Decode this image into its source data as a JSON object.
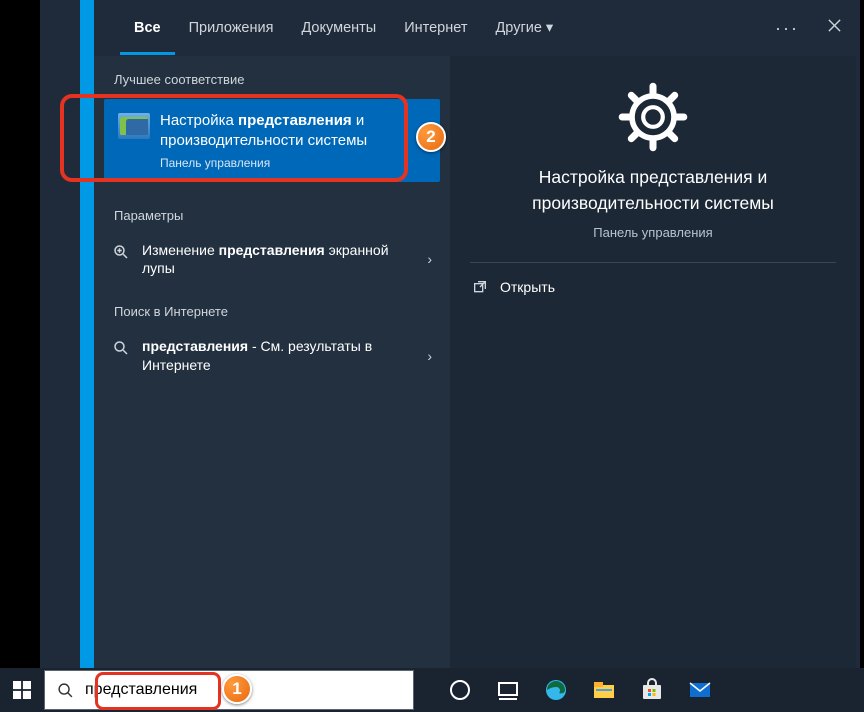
{
  "tabs": {
    "all": "Все",
    "apps": "Приложения",
    "docs": "Документы",
    "web": "Интернет",
    "more": "Другие"
  },
  "sections": {
    "best_match": "Лучшее соответствие",
    "settings": "Параметры",
    "web_search": "Поиск в Интернете"
  },
  "best": {
    "title_pre": "Настройка ",
    "title_bold": "представления",
    "title_post": " и производительности системы",
    "subtitle": "Панель управления"
  },
  "results": {
    "magnifier_pre": "Изменение ",
    "magnifier_bold": "представления",
    "magnifier_post": " экранной лупы",
    "web_bold": "представления",
    "web_tail": " - См. результаты в Интернете"
  },
  "preview": {
    "title": "Настройка представления и производительности системы",
    "subtitle": "Панель управления",
    "open": "Открыть"
  },
  "search": {
    "value": "представления"
  },
  "callouts": {
    "one": "1",
    "two": "2"
  }
}
